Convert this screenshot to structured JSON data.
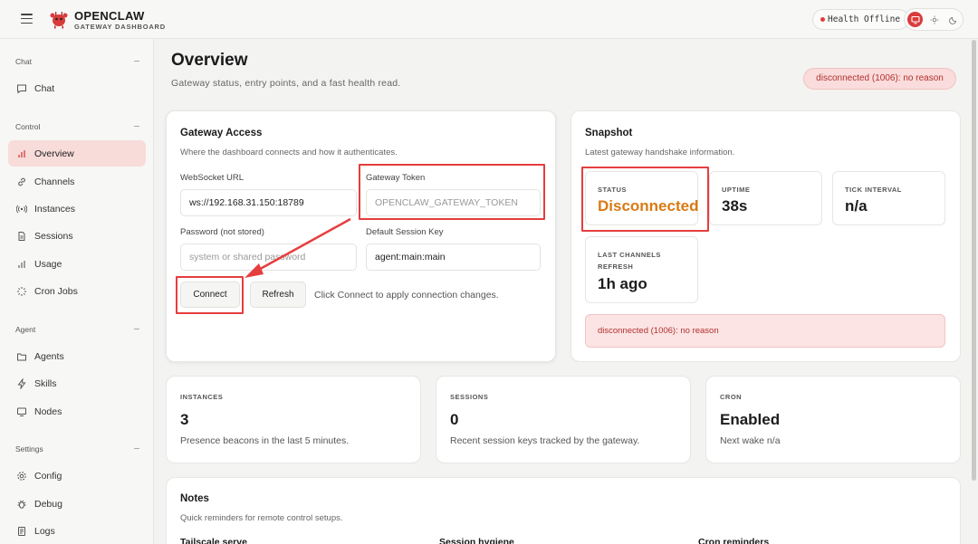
{
  "header": {
    "brand_name": "OPENCLAW",
    "brand_sub": "GATEWAY DASHBOARD",
    "health_label": "Health Offline",
    "icons": [
      "menu-icon",
      "lobster-logo-icon",
      "monitor-icon",
      "sun-icon",
      "moon-icon"
    ],
    "accent": "#d93b3b"
  },
  "sidebar": {
    "sections": [
      {
        "title": "Chat",
        "items": [
          {
            "label": "Chat",
            "icon": "chat-bubble-icon"
          }
        ]
      },
      {
        "title": "Control",
        "items": [
          {
            "label": "Overview",
            "icon": "bar-chart-icon",
            "active": true
          },
          {
            "label": "Channels",
            "icon": "link-icon"
          },
          {
            "label": "Instances",
            "icon": "radio-icon"
          },
          {
            "label": "Sessions",
            "icon": "document-icon"
          },
          {
            "label": "Usage",
            "icon": "bar-chart-icon"
          },
          {
            "label": "Cron Jobs",
            "icon": "loader-icon"
          }
        ]
      },
      {
        "title": "Agent",
        "items": [
          {
            "label": "Agents",
            "icon": "folder-icon"
          },
          {
            "label": "Skills",
            "icon": "lightning-icon"
          },
          {
            "label": "Nodes",
            "icon": "monitor-icon"
          }
        ]
      },
      {
        "title": "Settings",
        "items": [
          {
            "label": "Config",
            "icon": "gear-icon"
          },
          {
            "label": "Debug",
            "icon": "bug-icon"
          },
          {
            "label": "Logs",
            "icon": "file-text-icon"
          }
        ]
      }
    ]
  },
  "page": {
    "title": "Overview",
    "subtitle": "Gateway status, entry points, and a fast health read.",
    "error_pill": "disconnected (1006): no reason"
  },
  "gateway_access": {
    "title": "Gateway Access",
    "subtitle": "Where the dashboard connects and how it authenticates.",
    "ws_label": "WebSocket URL",
    "ws_value": "ws://192.168.31.150:18789",
    "token_label": "Gateway Token",
    "token_placeholder": "OPENCLAW_GATEWAY_TOKEN",
    "password_label": "Password (not stored)",
    "password_placeholder": "system or shared password",
    "session_label": "Default Session Key",
    "session_value": "agent:main:main",
    "connect_label": "Connect",
    "refresh_label": "Refresh",
    "hint": "Click Connect to apply connection changes."
  },
  "snapshot": {
    "title": "Snapshot",
    "subtitle": "Latest gateway handshake information.",
    "status_label": "STATUS",
    "status_value": "Disconnected",
    "status_color": "#d97a14",
    "uptime_label": "UPTIME",
    "uptime_value": "38s",
    "tick_label": "TICK INTERVAL",
    "tick_value": "n/a",
    "last_refresh_label": "LAST CHANNELS REFRESH",
    "last_refresh_value": "1h ago",
    "error": "disconnected (1006): no reason"
  },
  "stats": {
    "instances": {
      "label": "INSTANCES",
      "value": "3",
      "sub": "Presence beacons in the last 5 minutes."
    },
    "sessions": {
      "label": "SESSIONS",
      "value": "0",
      "sub": "Recent session keys tracked by the gateway."
    },
    "cron": {
      "label": "CRON",
      "value": "Enabled",
      "sub": "Next wake n/a"
    }
  },
  "notes": {
    "title": "Notes",
    "subtitle": "Quick reminders for remote control setups.",
    "items": [
      "Tailscale serve",
      "Session hygiene",
      "Cron reminders"
    ]
  }
}
